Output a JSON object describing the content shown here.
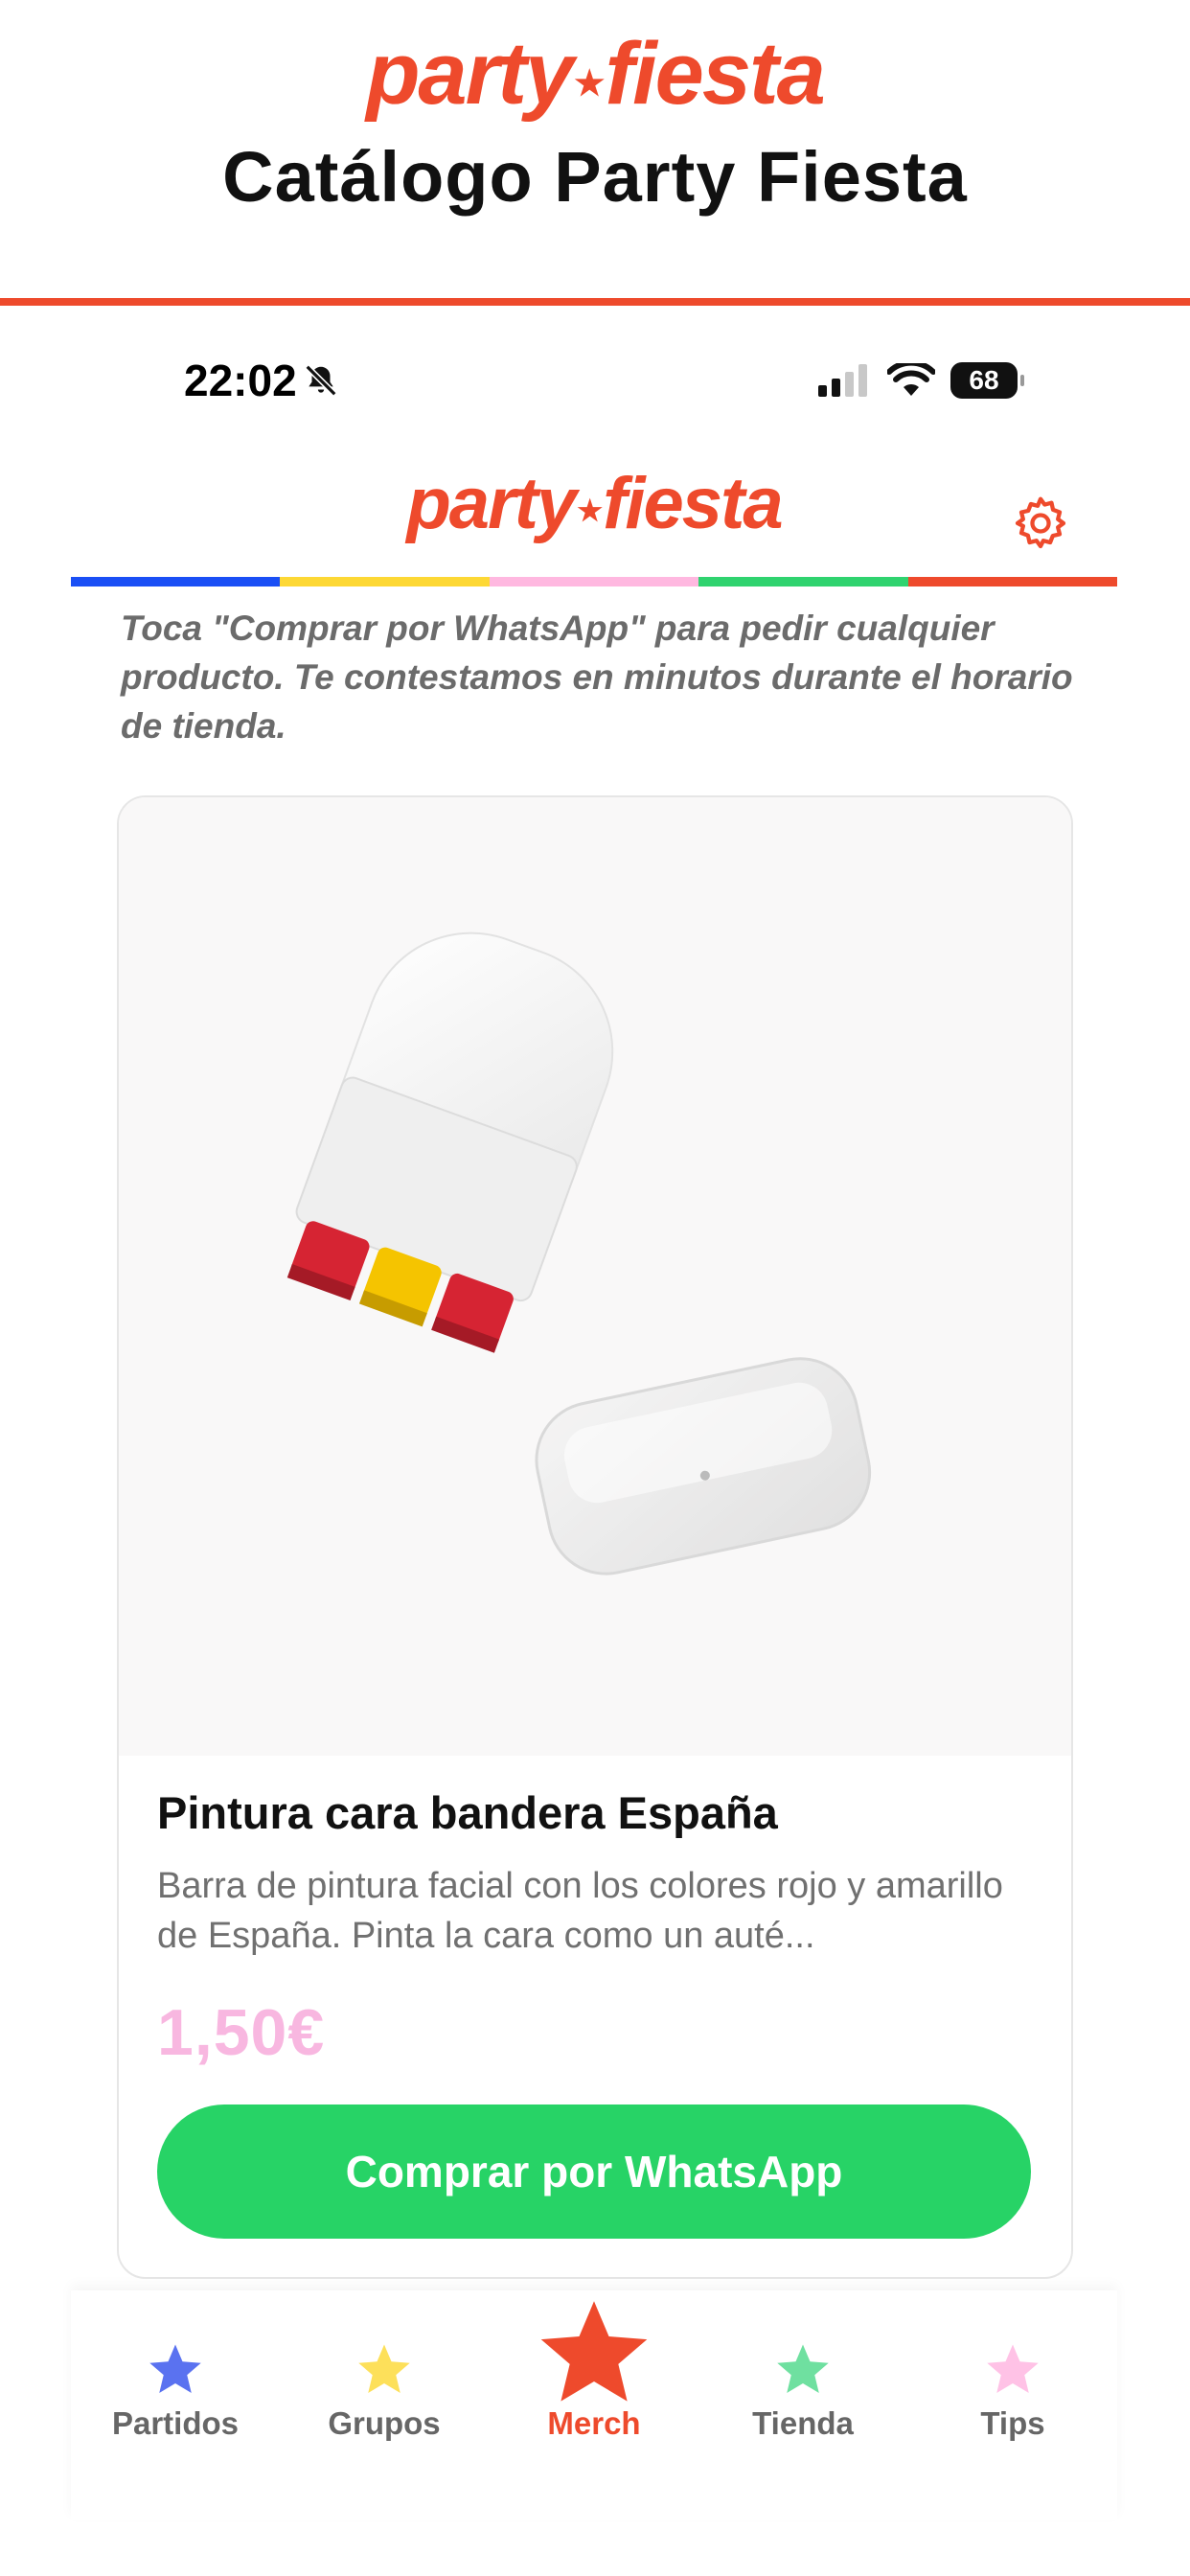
{
  "header": {
    "logo_left": "party",
    "logo_right": "fiesta",
    "title": "Catálogo Party Fiesta"
  },
  "status_bar": {
    "time": "22:02",
    "battery": "68"
  },
  "app_header": {
    "logo_left": "party",
    "logo_right": "fiesta",
    "settings_icon": "gear-icon",
    "stripe_colors": [
      "#1a4ff5",
      "#fdd835",
      "#ffb8e0",
      "#2fd36f",
      "#ee4a2c"
    ]
  },
  "intro_text": "Toca \"Comprar por WhatsApp\" para pedir cualquier producto. Te contestamos en minutos durante el horario de tienda.",
  "product": {
    "title": "Pintura cara bandera España",
    "description": "Barra de pintura facial con los colores rojo y amarillo de España. Pinta la cara como un auté...",
    "price": "1,50€",
    "buy_label": "Comprar por WhatsApp"
  },
  "tabbar": {
    "tabs": [
      {
        "label": "Partidos",
        "color": "#5a72f0"
      },
      {
        "label": "Grupos",
        "color": "#fde05a"
      },
      {
        "label": "Merch",
        "color": "#ee4a2c",
        "active": true
      },
      {
        "label": "Tienda",
        "color": "#6fe0a0"
      },
      {
        "label": "Tips",
        "color": "#ffc2e6"
      }
    ]
  },
  "colors": {
    "brand": "#ee4a2c",
    "whatsapp_green": "#27d366",
    "price_pink": "#f8b7e0"
  }
}
